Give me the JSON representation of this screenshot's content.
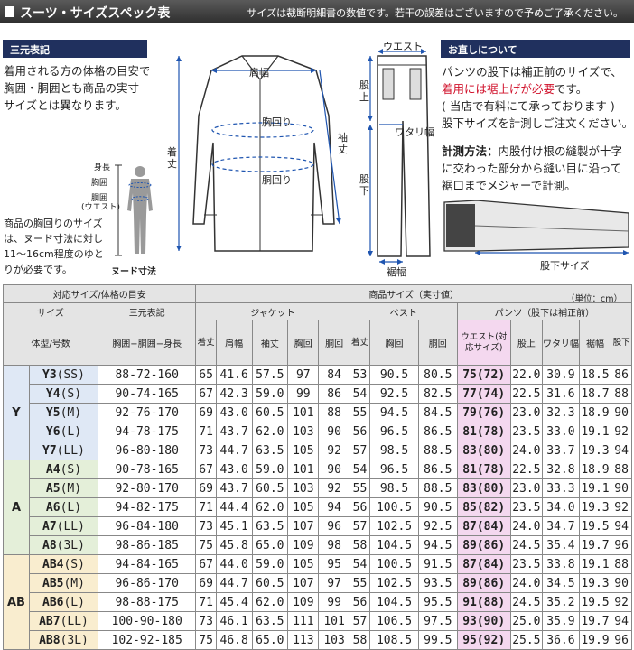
{
  "header": {
    "title": "スーツ・サイズスペック表",
    "note": "サイズは裁断明細書の数値です。若干の誤差はございますので予めご了承ください。"
  },
  "sangen": {
    "heading": "三元表記",
    "lines": [
      "着用される方の体格の目安で",
      "胸囲・胴囲とも商品の実寸",
      "サイズとは異なります。"
    ],
    "body_labels": [
      "身長",
      "胸囲",
      "胴囲",
      "(ウエスト)"
    ],
    "nude_label": "ヌード寸法",
    "note_lines": [
      "商品の胸回りのサイズ",
      "は、ヌード寸法に対し",
      "11～16cm程度のゆと",
      "りが必要です。"
    ]
  },
  "jacket_labels": {
    "katahaba": "肩幅",
    "munemawari": "胸回り",
    "domawari": "胴回り",
    "kitake": "着丈",
    "yuki": "袖丈"
  },
  "pants_labels": {
    "waist": "ウエスト",
    "jouge": "股上",
    "watari": "ワタリ幅",
    "mata": "股下",
    "suso": "裾幅"
  },
  "alter": {
    "heading": "お直しについて",
    "p1a": "パンツの股下は補正前のサイズで、",
    "p1b": "着用には裾上げが必要",
    "p1c": "です。",
    "p2": "( 当店で有料にて承っております )",
    "p3": "股下サイズを計測しご注文ください。",
    "m_label": "計測方法：",
    "m1": "内股付け根の縫製が十字",
    "m2": "に交わった部分から縫い目に沿って",
    "m3": "裾口までメジャーで計測。",
    "fig_label": "股下サイズ"
  },
  "table": {
    "h1": {
      "taio": "対応サイズ/体格の目安",
      "shohin": "商品サイズ（実寸値）",
      "unit": "（単位：cm）"
    },
    "h2": {
      "size": "サイズ",
      "sangen": "三元表記",
      "jacket": "ジャケット",
      "vest": "ベスト",
      "pants": "パンツ（股下は補正前）"
    },
    "h3": {
      "taikei": "体型/号数",
      "sangen_detail": "胸囲−胴囲−身長",
      "j_kitake": "着丈",
      "j_kata": "肩幅",
      "j_sode": "袖丈",
      "j_mune": "胸回",
      "j_do": "胴回",
      "v_kitake": "着丈",
      "v_mune": "胸回",
      "v_do": "胴回",
      "p_waist": "ウエスト(対応サイズ)",
      "p_jouge": "股上",
      "p_watari": "ワタリ幅",
      "p_suso": "裾幅",
      "p_mata": "股下"
    },
    "groups": [
      {
        "name": "Y",
        "rows": [
          {
            "code": "Y3",
            "size": "(SS)",
            "sangen": "88-72-160",
            "j": [
              "65",
              "41.6",
              "57.5",
              "97",
              "84"
            ],
            "v": [
              "53",
              "90.5",
              "80.5"
            ],
            "p": [
              "75(72)",
              "22.0",
              "30.9",
              "18.5",
              "86"
            ]
          },
          {
            "code": "Y4",
            "size": "(S)",
            "sangen": "90-74-165",
            "j": [
              "67",
              "42.3",
              "59.0",
              "99",
              "86"
            ],
            "v": [
              "54",
              "92.5",
              "82.5"
            ],
            "p": [
              "77(74)",
              "22.5",
              "31.6",
              "18.7",
              "88"
            ]
          },
          {
            "code": "Y5",
            "size": "(M)",
            "sangen": "92-76-170",
            "j": [
              "69",
              "43.0",
              "60.5",
              "101",
              "88"
            ],
            "v": [
              "55",
              "94.5",
              "84.5"
            ],
            "p": [
              "79(76)",
              "23.0",
              "32.3",
              "18.9",
              "90"
            ]
          },
          {
            "code": "Y6",
            "size": "(L)",
            "sangen": "94-78-175",
            "j": [
              "71",
              "43.7",
              "62.0",
              "103",
              "90"
            ],
            "v": [
              "56",
              "96.5",
              "86.5"
            ],
            "p": [
              "81(78)",
              "23.5",
              "33.0",
              "19.1",
              "92"
            ]
          },
          {
            "code": "Y7",
            "size": "(LL)",
            "sangen": "96-80-180",
            "j": [
              "73",
              "44.7",
              "63.5",
              "105",
              "92"
            ],
            "v": [
              "57",
              "98.5",
              "88.5"
            ],
            "p": [
              "83(80)",
              "24.0",
              "33.7",
              "19.3",
              "94"
            ]
          }
        ]
      },
      {
        "name": "A",
        "rows": [
          {
            "code": "A4",
            "size": "(S)",
            "sangen": "90-78-165",
            "j": [
              "67",
              "43.0",
              "59.0",
              "101",
              "90"
            ],
            "v": [
              "54",
              "96.5",
              "86.5"
            ],
            "p": [
              "81(78)",
              "22.5",
              "32.8",
              "18.9",
              "88"
            ]
          },
          {
            "code": "A5",
            "size": "(M)",
            "sangen": "92-80-170",
            "j": [
              "69",
              "43.7",
              "60.5",
              "103",
              "92"
            ],
            "v": [
              "55",
              "98.5",
              "88.5"
            ],
            "p": [
              "83(80)",
              "23.0",
              "33.3",
              "19.1",
              "90"
            ]
          },
          {
            "code": "A6",
            "size": "(L)",
            "sangen": "94-82-175",
            "j": [
              "71",
              "44.4",
              "62.0",
              "105",
              "94"
            ],
            "v": [
              "56",
              "100.5",
              "90.5"
            ],
            "p": [
              "85(82)",
              "23.5",
              "34.0",
              "19.3",
              "92"
            ]
          },
          {
            "code": "A7",
            "size": "(LL)",
            "sangen": "96-84-180",
            "j": [
              "73",
              "45.1",
              "63.5",
              "107",
              "96"
            ],
            "v": [
              "57",
              "102.5",
              "92.5"
            ],
            "p": [
              "87(84)",
              "24.0",
              "34.7",
              "19.5",
              "94"
            ]
          },
          {
            "code": "A8",
            "size": "(3L)",
            "sangen": "98-86-185",
            "j": [
              "75",
              "45.8",
              "65.0",
              "109",
              "98"
            ],
            "v": [
              "58",
              "104.5",
              "94.5"
            ],
            "p": [
              "89(86)",
              "24.5",
              "35.4",
              "19.7",
              "96"
            ]
          }
        ]
      },
      {
        "name": "AB",
        "rows": [
          {
            "code": "AB4",
            "size": "(S)",
            "sangen": "94-84-165",
            "j": [
              "67",
              "44.0",
              "59.0",
              "105",
              "95"
            ],
            "v": [
              "54",
              "100.5",
              "91.5"
            ],
            "p": [
              "87(84)",
              "23.5",
              "33.8",
              "19.1",
              "88"
            ]
          },
          {
            "code": "AB5",
            "size": "(M)",
            "sangen": "96-86-170",
            "j": [
              "69",
              "44.7",
              "60.5",
              "107",
              "97"
            ],
            "v": [
              "55",
              "102.5",
              "93.5"
            ],
            "p": [
              "89(86)",
              "24.0",
              "34.5",
              "19.3",
              "90"
            ]
          },
          {
            "code": "AB6",
            "size": "(L)",
            "sangen": "98-88-175",
            "j": [
              "71",
              "45.4",
              "62.0",
              "109",
              "99"
            ],
            "v": [
              "56",
              "104.5",
              "95.5"
            ],
            "p": [
              "91(88)",
              "24.5",
              "35.2",
              "19.5",
              "92"
            ]
          },
          {
            "code": "AB7",
            "size": "(LL)",
            "sangen": "100-90-180",
            "j": [
              "73",
              "46.1",
              "63.5",
              "111",
              "101"
            ],
            "v": [
              "57",
              "106.5",
              "97.5"
            ],
            "p": [
              "93(90)",
              "25.0",
              "35.9",
              "19.7",
              "94"
            ]
          },
          {
            "code": "AB8",
            "size": "(3L)",
            "sangen": "102-92-185",
            "j": [
              "75",
              "46.8",
              "65.0",
              "113",
              "103"
            ],
            "v": [
              "58",
              "108.5",
              "99.5"
            ],
            "p": [
              "95(92)",
              "25.5",
              "36.6",
              "19.9",
              "96"
            ]
          }
        ]
      }
    ]
  }
}
